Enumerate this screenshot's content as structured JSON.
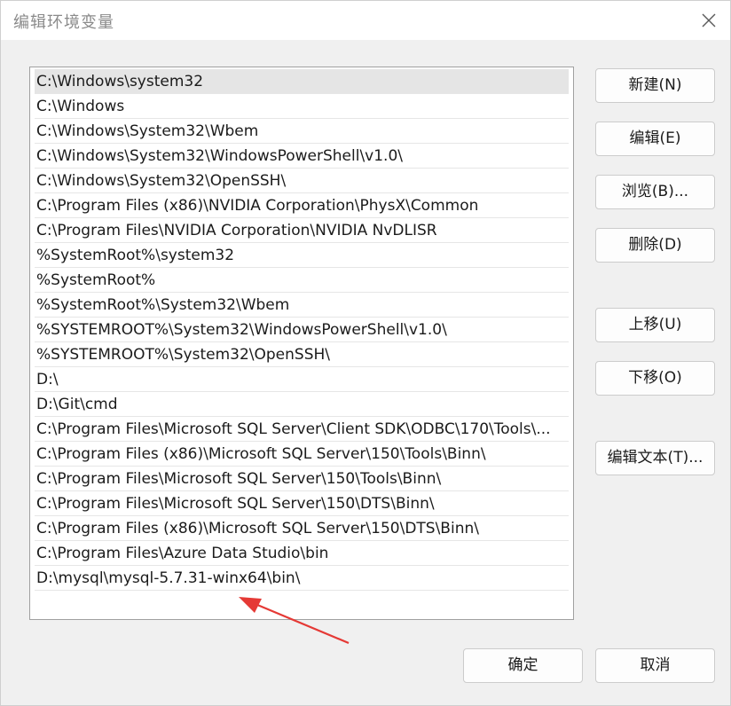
{
  "dialog": {
    "title": "编辑环境变量"
  },
  "list": {
    "items": [
      "C:\\Windows\\system32",
      "C:\\Windows",
      "C:\\Windows\\System32\\Wbem",
      "C:\\Windows\\System32\\WindowsPowerShell\\v1.0\\",
      "C:\\Windows\\System32\\OpenSSH\\",
      "C:\\Program Files (x86)\\NVIDIA Corporation\\PhysX\\Common",
      "C:\\Program Files\\NVIDIA Corporation\\NVIDIA NvDLISR",
      "%SystemRoot%\\system32",
      "%SystemRoot%",
      "%SystemRoot%\\System32\\Wbem",
      "%SYSTEMROOT%\\System32\\WindowsPowerShell\\v1.0\\",
      "%SYSTEMROOT%\\System32\\OpenSSH\\",
      "D:\\",
      "D:\\Git\\cmd",
      "C:\\Program Files\\Microsoft SQL Server\\Client SDK\\ODBC\\170\\Tools\\...",
      "C:\\Program Files (x86)\\Microsoft SQL Server\\150\\Tools\\Binn\\",
      "C:\\Program Files\\Microsoft SQL Server\\150\\Tools\\Binn\\",
      "C:\\Program Files\\Microsoft SQL Server\\150\\DTS\\Binn\\",
      "C:\\Program Files (x86)\\Microsoft SQL Server\\150\\DTS\\Binn\\",
      "C:\\Program Files\\Azure Data Studio\\bin",
      "D:\\mysql\\mysql-5.7.31-winx64\\bin\\"
    ]
  },
  "buttons": {
    "new": "新建(N)",
    "edit": "编辑(E)",
    "browse": "浏览(B)...",
    "delete": "删除(D)",
    "move_up": "上移(U)",
    "move_down": "下移(O)",
    "edit_text": "编辑文本(T)...",
    "ok": "确定",
    "cancel": "取消"
  },
  "colors": {
    "annotation_arrow": "#e53935",
    "selected_row": "#e5e5e5"
  }
}
